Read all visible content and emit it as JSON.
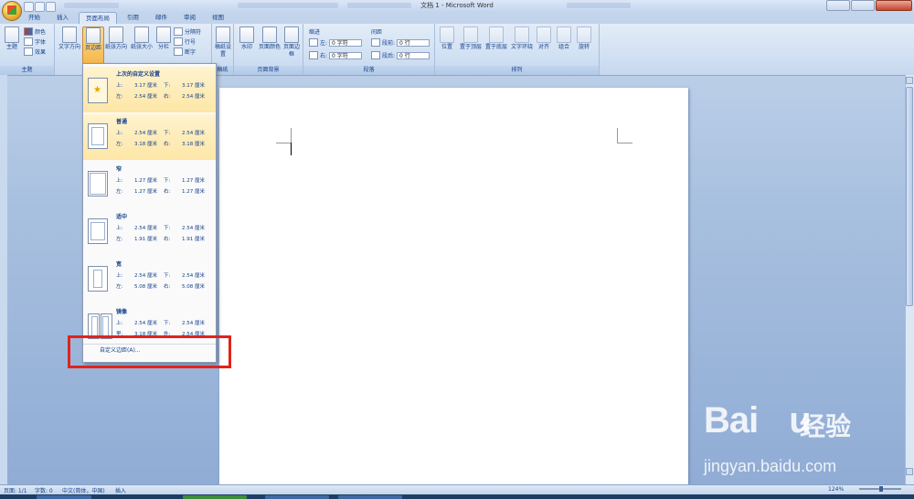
{
  "window": {
    "title": "文档 1 - Microsoft Word"
  },
  "tabs": [
    {
      "label": "开始"
    },
    {
      "label": "插入"
    },
    {
      "label": "页面布局"
    },
    {
      "label": "引用"
    },
    {
      "label": "邮件"
    },
    {
      "label": "审阅"
    },
    {
      "label": "视图"
    }
  ],
  "ribbon": {
    "theme_group": {
      "label": "主题",
      "theme_btn": "主题",
      "colors": "颜色",
      "fonts": "字体",
      "effects": "效果"
    },
    "page_setup": {
      "text_direction": "文字方向",
      "margins": "页边距",
      "orientation": "纸张方向",
      "size": "纸张大小",
      "columns": "分栏",
      "breaks": "分隔符",
      "line_numbers": "行号",
      "hyphenation": "断字"
    },
    "draft": {
      "label": "稿纸",
      "btn": "稿纸设置"
    },
    "page_background": {
      "label": "页面背景",
      "watermark": "水印",
      "page_color": "页面颜色",
      "page_borders": "页面边框"
    },
    "paragraph": {
      "label": "段落",
      "indent": "缩进",
      "left": "左:",
      "right": "右:",
      "left_val": "0 字符",
      "right_val": "0 字符",
      "spacing": "间距",
      "before": "段前:",
      "after": "段后:",
      "before_val": "0 行",
      "after_val": "0 行"
    },
    "arrange": {
      "label": "排列",
      "position": "位置",
      "bring_front": "置于顶层",
      "send_back": "置于底层",
      "wrap": "文字环绕",
      "align": "对齐",
      "group": "组合",
      "rotate": "旋转"
    }
  },
  "margins_menu": {
    "options": [
      {
        "name": "上次的自定义设置",
        "top_label": "上:",
        "top": "3.17 厘米",
        "bottom_label": "下:",
        "bottom": "3.17 厘米",
        "left_label": "左:",
        "left": "2.54 厘米",
        "right_label": "右:",
        "right": "2.54 厘米"
      },
      {
        "name": "普通",
        "top_label": "上:",
        "top": "2.54 厘米",
        "bottom_label": "下:",
        "bottom": "2.54 厘米",
        "left_label": "左:",
        "left": "3.18 厘米",
        "right_label": "右:",
        "right": "3.18 厘米"
      },
      {
        "name": "窄",
        "top_label": "上:",
        "top": "1.27 厘米",
        "bottom_label": "下:",
        "bottom": "1.27 厘米",
        "left_label": "左:",
        "left": "1.27 厘米",
        "right_label": "右:",
        "right": "1.27 厘米"
      },
      {
        "name": "适中",
        "top_label": "上:",
        "top": "2.54 厘米",
        "bottom_label": "下:",
        "bottom": "2.54 厘米",
        "left_label": "左:",
        "left": "1.91 厘米",
        "right_label": "右:",
        "right": "1.91 厘米"
      },
      {
        "name": "宽",
        "top_label": "上:",
        "top": "2.54 厘米",
        "bottom_label": "下:",
        "bottom": "2.54 厘米",
        "left_label": "左:",
        "left": "5.08 厘米",
        "right_label": "右:",
        "right": "5.08 厘米"
      },
      {
        "name": "镜像",
        "top_label": "上:",
        "top": "2.54 厘米",
        "bottom_label": "下:",
        "bottom": "2.54 厘米",
        "left_label": "里:",
        "left": "3.18 厘米",
        "right_label": "外:",
        "right": "2.54 厘米"
      }
    ],
    "custom": "自定义边距(A)..."
  },
  "status": {
    "page": "页面: 1/1",
    "words": "字数: 0",
    "language": "中文(简体，中国)",
    "mode": "插入",
    "zoom": "124%"
  },
  "watermark": {
    "logo": "Bai 经验",
    "url": "jingyan.baidu.com"
  },
  "colors": {
    "highlight": "#e0231c",
    "accent": "#15428b"
  }
}
